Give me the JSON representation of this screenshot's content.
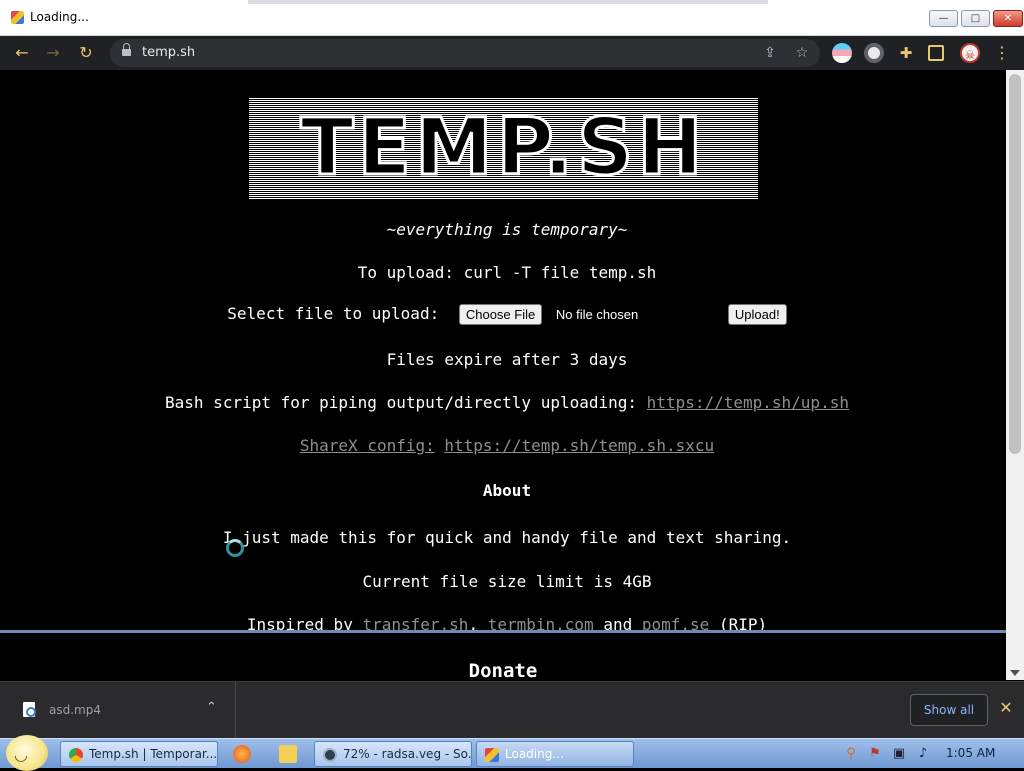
{
  "window": {
    "title": "Loading...",
    "controls": {
      "minimize": "—",
      "maximize": "□",
      "close": "✕"
    }
  },
  "toolbar": {
    "url": "temp.sh",
    "icons": [
      "back-icon",
      "forward-icon",
      "reload-icon",
      "lock-icon",
      "share-icon",
      "bookmark-star-icon",
      "extension-icon",
      "puzzle-icon",
      "sidepanel-icon",
      "profile-avatar-icon",
      "menu-kebab-icon"
    ]
  },
  "page": {
    "logo_text": "TEMP.SH",
    "tagline": "~everything is temporary~",
    "upload_cmd": "To upload: curl -T file temp.sh",
    "select_label": "Select file to upload:",
    "choose_file_label": "Choose File",
    "no_file_label": "No file chosen",
    "upload_button": "Upload!",
    "expire_text": "Files expire after 3 days",
    "bash_label": "Bash script for piping output/directly uploading:",
    "bash_link": "https://temp.sh/up.sh",
    "sharex_label": "ShareX config:",
    "sharex_link": "https://temp.sh/temp.sh.sxcu",
    "about_heading": "About",
    "about_text": "I just made this for quick and handy file and text sharing.",
    "size_limit": "Current file size limit is 4GB",
    "inspired_prefix": "Inspired by",
    "inspired_link1": "transfer.sh",
    "inspired_comma": ",",
    "inspired_link2": "termbin.com",
    "inspired_and": "and",
    "inspired_link3": "pomf.se",
    "inspired_suffix": "(RIP)",
    "donate_heading": "Donate"
  },
  "downloads": {
    "file_name": "asd.mp4",
    "show_all": "Show all",
    "close": "✕"
  },
  "taskbar": {
    "tasks": [
      {
        "label": "Temp.sh | Temporar..."
      },
      {
        "label": "72% - radsa.veg - So..."
      },
      {
        "label": "Loading..."
      }
    ],
    "clock": "1:05 AM"
  },
  "colors": {
    "browser_dark": "#202124",
    "accent_yellow": "#e8c86f",
    "link_gray": "#8f8f8f",
    "show_all_blue": "#8ab4f8",
    "taskbar_blue": "#6f98d2"
  }
}
